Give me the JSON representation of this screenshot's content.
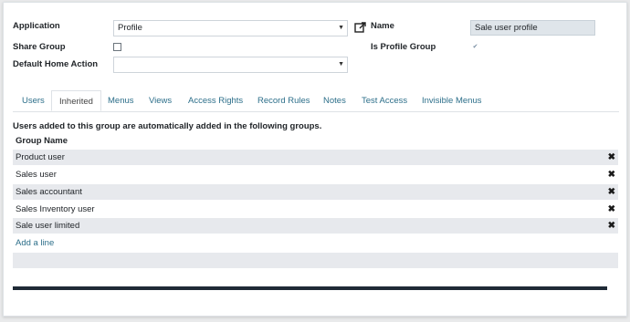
{
  "form": {
    "application_label": "Application",
    "application_value": "Profile",
    "name_label": "Name",
    "name_value": "Sale user profile",
    "share_group_label": "Share Group",
    "is_profile_group_label": "Is Profile Group",
    "default_home_action_label": "Default Home Action",
    "default_home_action_value": ""
  },
  "tabs": [
    {
      "label": "Users"
    },
    {
      "label": "Inherited"
    },
    {
      "label": "Menus"
    },
    {
      "label": "Views"
    },
    {
      "label": "Access Rights"
    },
    {
      "label": "Record Rules"
    },
    {
      "label": "Notes"
    },
    {
      "label": "Test Access"
    },
    {
      "label": "Invisible Menus"
    }
  ],
  "inherited": {
    "description": "Users added to this group are automatically added in the following groups.",
    "column_header": "Group Name",
    "rows": [
      {
        "name": "Product user"
      },
      {
        "name": "Sales user"
      },
      {
        "name": "Sales accountant"
      },
      {
        "name": "Sales Inventory user"
      },
      {
        "name": "Sale user limited"
      }
    ],
    "add_line": "Add a line"
  },
  "icons": {
    "caret": "caret-down-icon",
    "external": "external-link-icon",
    "delete": "delete-row-icon"
  }
}
